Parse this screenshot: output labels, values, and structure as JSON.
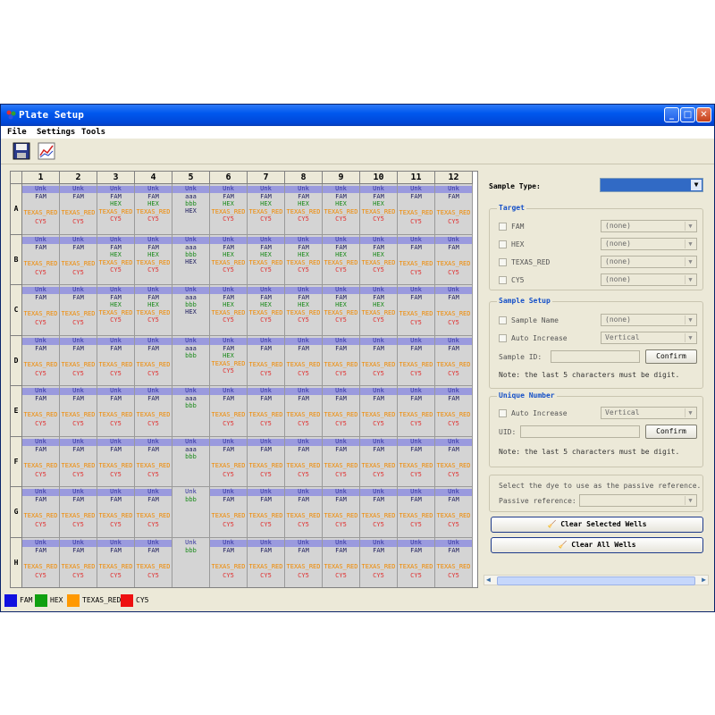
{
  "window": {
    "title": "Plate Setup"
  },
  "menu": [
    "File",
    "Settings",
    "Tools"
  ],
  "toolbar": {
    "save_icon": "save-icon",
    "chart_icon": "chart-icon"
  },
  "plate": {
    "columns": [
      "1",
      "2",
      "3",
      "4",
      "5",
      "6",
      "7",
      "8",
      "9",
      "10",
      "11",
      "12"
    ],
    "rows": [
      "A",
      "B",
      "C",
      "D",
      "E",
      "F",
      "G",
      "H"
    ],
    "cell_texts": {
      "unk": "Unk",
      "fam": "FAM",
      "hex": "HEX",
      "tex": "TEXAS_RED",
      "cy5": "CY5",
      "aaa": "aaa",
      "bbb": "bbb"
    }
  },
  "sample_type": {
    "label": "Sample Type:",
    "value": ""
  },
  "target": {
    "title": "Target",
    "items": [
      {
        "label": "FAM",
        "value": "(none)"
      },
      {
        "label": "HEX",
        "value": "(none)"
      },
      {
        "label": "TEXAS_RED",
        "value": "(none)"
      },
      {
        "label": "CY5",
        "value": "(none)"
      }
    ]
  },
  "sample_setup": {
    "title": "Sample Setup",
    "sample_name_label": "Sample Name",
    "sample_name_value": "(none)",
    "auto_increase_label": "Auto Increase",
    "auto_increase_value": "Vertical",
    "sample_id_label": "Sample ID:",
    "confirm": "Confirm",
    "note": "Note: the last 5 characters must be digit."
  },
  "unique_number": {
    "title": "Unique Number",
    "auto_increase_label": "Auto Increase",
    "auto_increase_value": "Vertical",
    "uid_label": "UID:",
    "confirm": "Confirm",
    "note": "Note: the last 5 characters must be digit."
  },
  "passive": {
    "instruction": "Select the dye to use as the passive reference.",
    "label": "Passive reference:"
  },
  "buttons": {
    "clear_selected": "Clear Selected Wells",
    "clear_all": "Clear All Wells"
  },
  "legend": [
    {
      "label": "FAM",
      "color": "#1010e0"
    },
    {
      "label": "HEX",
      "color": "#10a010"
    },
    {
      "label": "TEXAS_RED",
      "color": "#ff9900"
    },
    {
      "label": "CY5",
      "color": "#ee1010"
    }
  ]
}
